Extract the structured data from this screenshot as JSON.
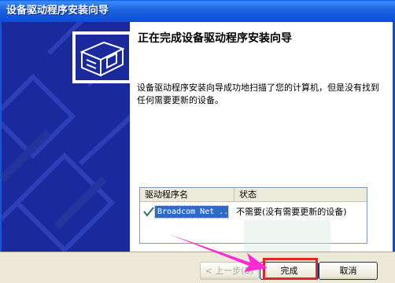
{
  "window": {
    "title": "设备驱动程序安装向导"
  },
  "wizard": {
    "heading": "正在完成设备驱动程序安装向导",
    "description": "设备驱动程序安装向导成功地扫描了您的计算机，但是没有找到任何需要更新的设备。"
  },
  "driver_list": {
    "columns": [
      "驱动程序名",
      "状态"
    ],
    "rows": [
      {
        "name": "Broadcom Net ...",
        "status": "不需要(没有需要更新的设备)"
      }
    ]
  },
  "buttons": {
    "back": "< 上一步(B)",
    "finish": "完成",
    "cancel": "取消"
  },
  "colors": {
    "sidebar": "#1a2a9c",
    "titlebar": "#0d4dd6",
    "highlight": "#e0252b",
    "arrow": "#ff2ad4"
  }
}
